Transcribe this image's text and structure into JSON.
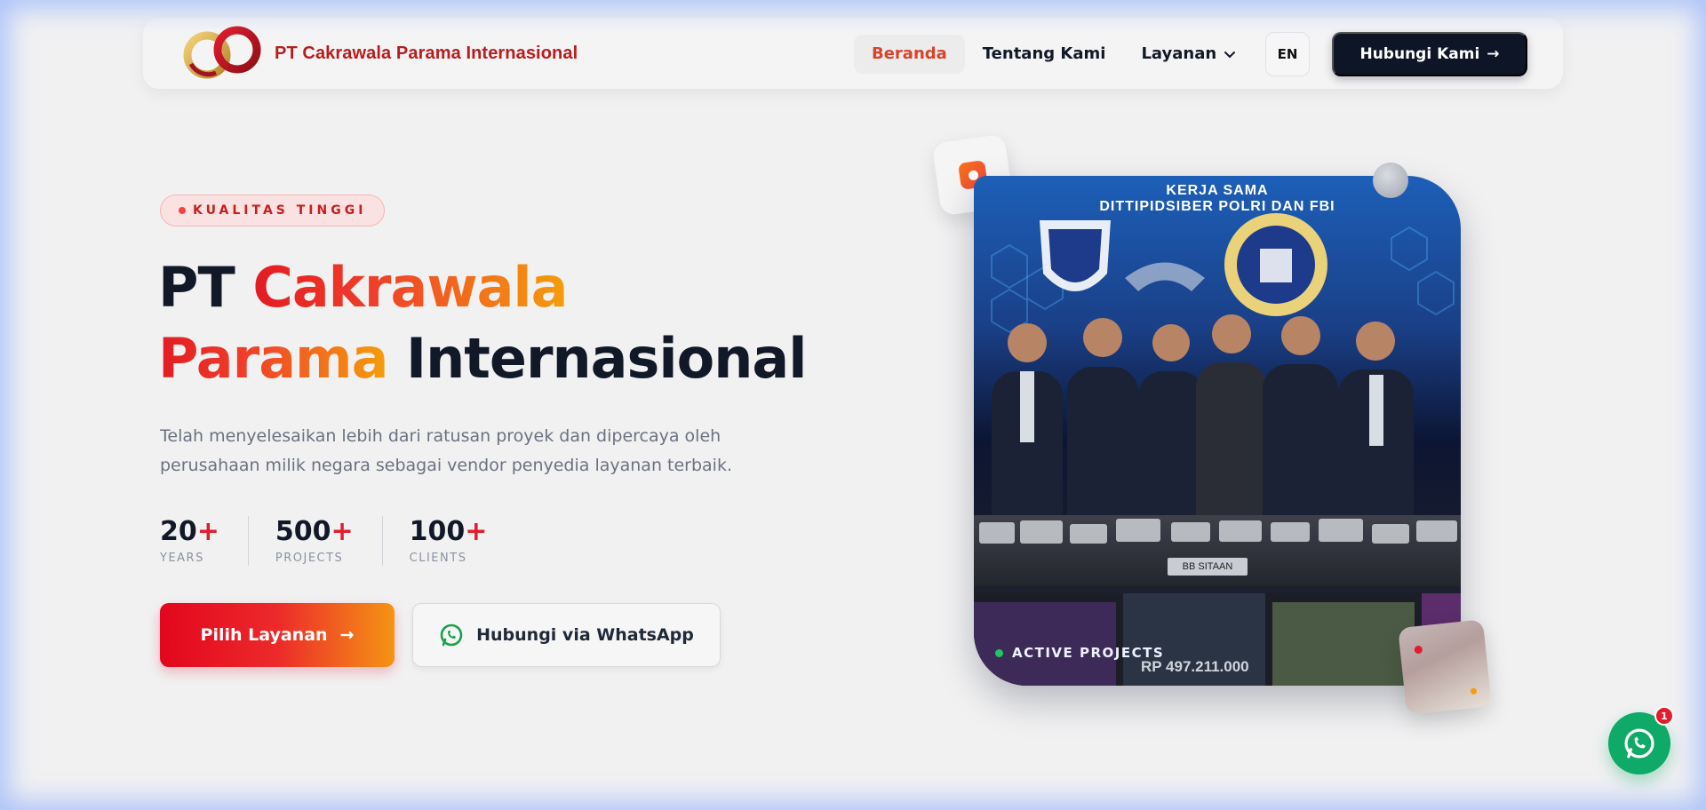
{
  "nav": {
    "brand_name": "PT Cakrawala Parama Internasional",
    "links": [
      {
        "label": "Beranda",
        "active": true
      },
      {
        "label": "Tentang Kami",
        "active": false
      },
      {
        "label": "Layanan",
        "active": false
      }
    ],
    "lang": "EN",
    "cta_label": "Hubungi Kami",
    "cta_arrow": "→"
  },
  "hero": {
    "badge": "KUALITAS TINGGI",
    "title": {
      "part1": "PT ",
      "part2": "Cakrawala",
      "part3": "Parama",
      "part4": " Internasional"
    },
    "description": "Telah menyelesaikan lebih dari ratusan proyek dan dipercaya oleh perusahaan milik negara sebagai vendor penyedia layanan terbaik.",
    "stats": [
      {
        "value": "20",
        "suffix": "+",
        "label": "YEARS"
      },
      {
        "value": "500",
        "suffix": "+",
        "label": "PROJECTS"
      },
      {
        "value": "100",
        "suffix": "+",
        "label": "CLIENTS"
      }
    ],
    "primary_button": "Pilih Layanan",
    "primary_arrow": "→",
    "secondary_button": "Hubungi via WhatsApp"
  },
  "showcase": {
    "screen_line1": "KERJA SAMA",
    "screen_line2": "DITTIPIDSIBER POLRI DAN FBI",
    "table_sign": "BB SITAAN",
    "active_label": "ACTIVE PROJECTS",
    "price": "RP 497.211.000"
  },
  "whatsapp_float": {
    "badge_count": "1"
  },
  "colors": {
    "brand_red": "#e11d2e",
    "brand_orange": "#f59e0b",
    "navy": "#0e1526",
    "whatsapp_green": "#0fa968"
  }
}
